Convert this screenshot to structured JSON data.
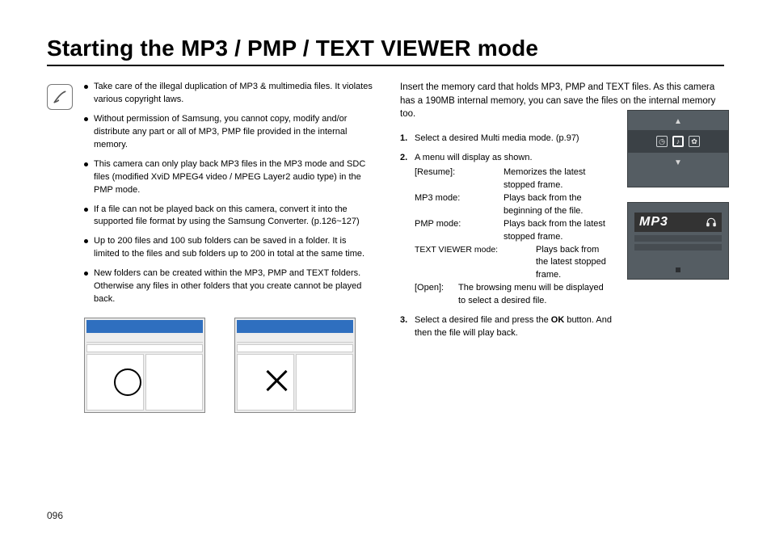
{
  "title": "Starting the MP3 / PMP / TEXT VIEWER mode",
  "page_number": "096",
  "notes": [
    "Take care of the illegal duplication of MP3 & multimedia files. It violates various copyright laws.",
    "Without permission of Samsung, you cannot copy, modify and/or distribute any part or all of MP3, PMP file provided in the internal memory.",
    "This camera can only play back MP3 files in the MP3 mode and SDC files (modified XviD MPEG4 video / MPEG Layer2 audio type) in the PMP mode.",
    "If a file can not be played back on this camera, convert it into the supported file format by using the Samsung Converter. (p.126~127)",
    "Up to 200 files and 100 sub folders can be saved in a folder. It is limited to the files and sub folders up to 200 in total at the same time.",
    "New folders can be created within the MP3, PMP and TEXT folders. Otherwise any files in other folders that you create cannot be played back."
  ],
  "intro": "Insert the memory card that holds MP3, PMP and TEXT files. As this camera has a 190MB internal memory, you can save the files on the internal memory too.",
  "steps": {
    "s1": "Select a desired Multi media mode. (p.97)",
    "s2_lead": "A menu will display as shown.",
    "defs": {
      "resume_t": "[Resume]:",
      "resume_d": "Memorizes the latest stopped frame.",
      "mp3_t": "MP3 mode:",
      "mp3_d": "Plays back from the beginning of the file.",
      "pmp_t": "PMP mode:",
      "pmp_d": "Plays back from the latest stopped frame.",
      "txt_t": "TEXT VIEWER mode:",
      "txt_d": "Plays back from the latest stopped frame.",
      "open_t": "[Open]:",
      "open_d": "The browsing menu will be displayed to select a desired file."
    },
    "s3_a": "Select a desired file and press the ",
    "s3_ok": "OK",
    "s3_b": " button. And then the file will play back."
  },
  "mp3_label": "MP3"
}
